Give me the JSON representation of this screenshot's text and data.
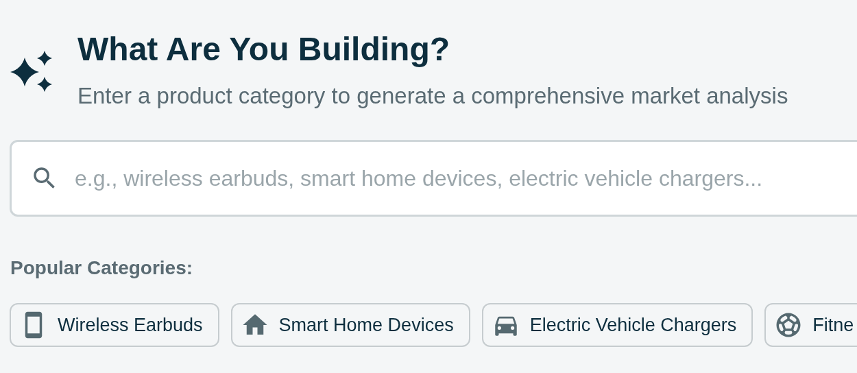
{
  "header": {
    "title": "What Are You Building?",
    "subtitle": "Enter a product category to generate a comprehensive market analysis"
  },
  "search": {
    "placeholder": "e.g., wireless earbuds, smart home devices, electric vehicle chargers..."
  },
  "popular": {
    "label": "Popular Categories:",
    "chips": [
      {
        "kind": "phone",
        "label": "Wireless Earbuds"
      },
      {
        "kind": "home",
        "label": "Smart Home Devices"
      },
      {
        "kind": "car",
        "label": "Electric Vehicle Chargers"
      },
      {
        "kind": "ball",
        "label": "Fitne"
      }
    ]
  }
}
